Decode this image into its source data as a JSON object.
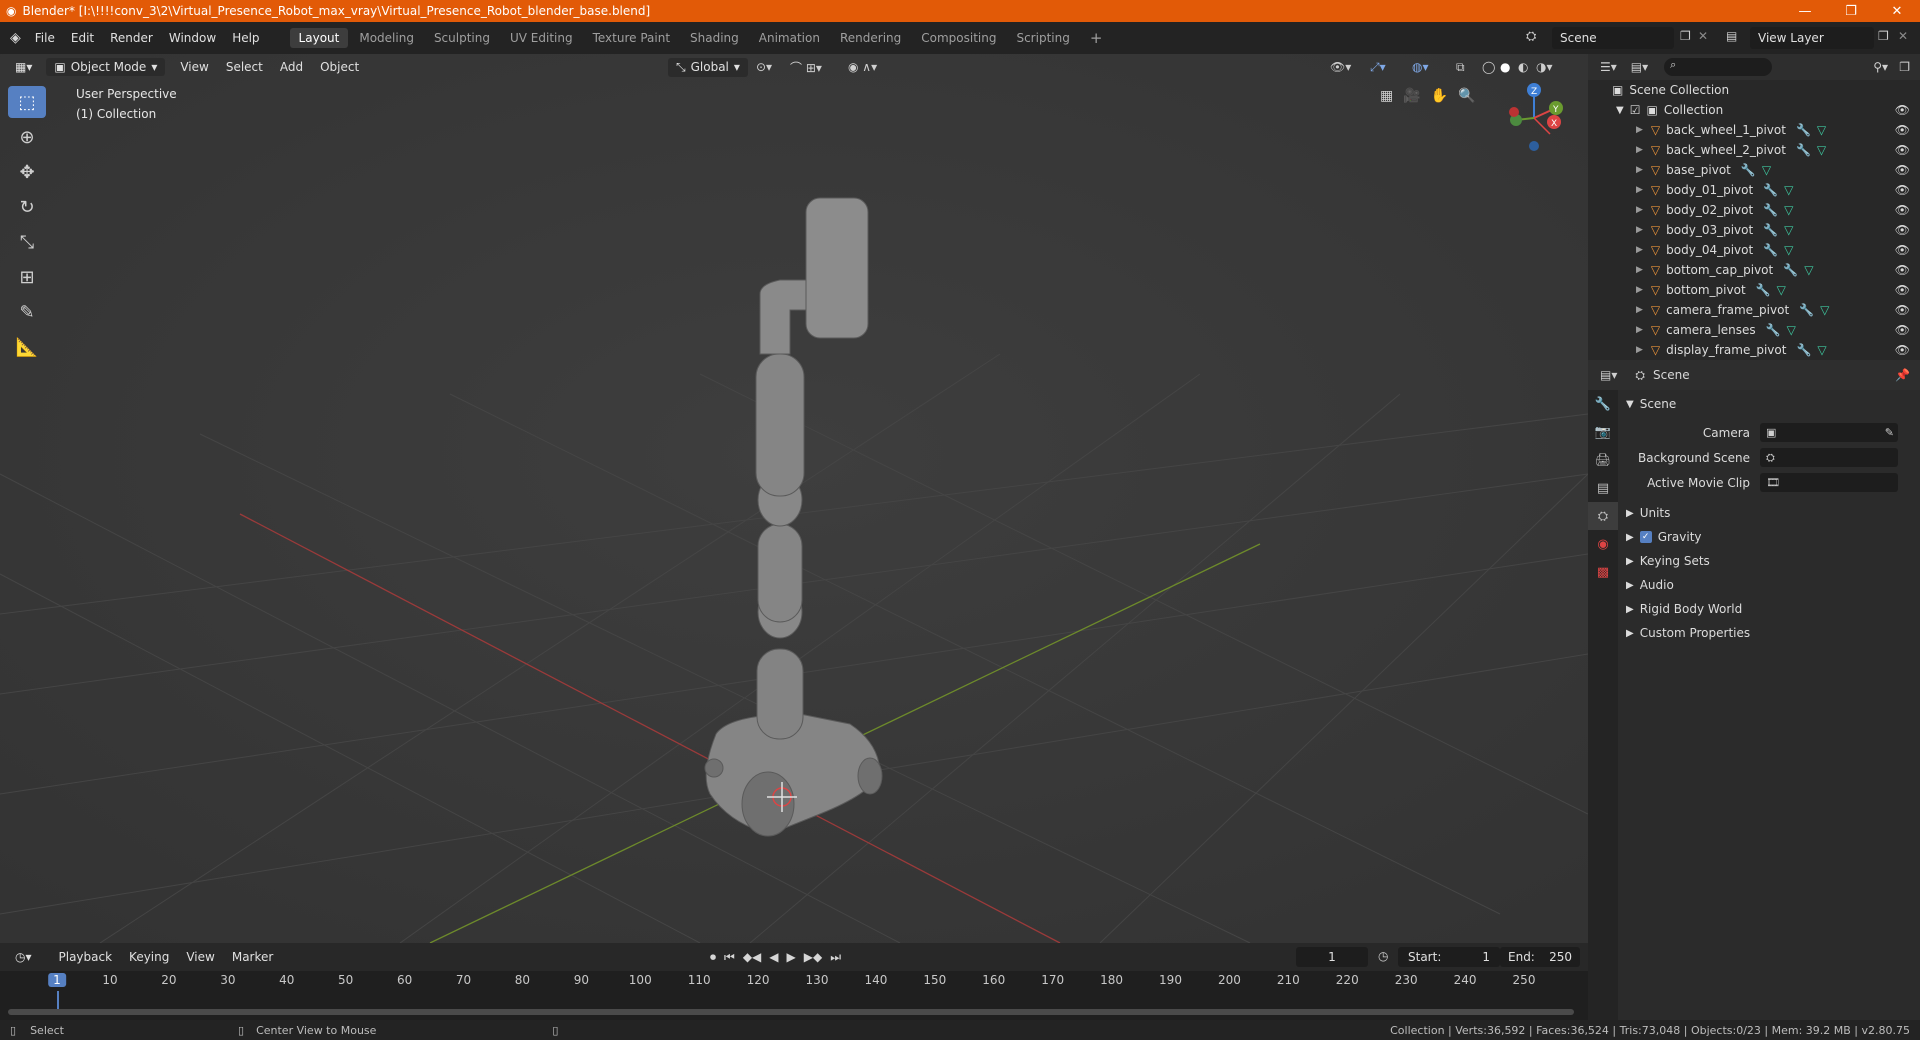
{
  "window": {
    "title": "Blender* [I:\\!!!!conv_3\\2\\Virtual_Presence_Robot_max_vray\\Virtual_Presence_Robot_blender_base.blend]"
  },
  "menu": [
    "File",
    "Edit",
    "Render",
    "Window",
    "Help"
  ],
  "workspaces": [
    "Layout",
    "Modeling",
    "Sculpting",
    "UV Editing",
    "Texture Paint",
    "Shading",
    "Animation",
    "Rendering",
    "Compositing",
    "Scripting"
  ],
  "active_workspace": "Layout",
  "scene_name": "Scene",
  "view_layer": "View Layer",
  "viewport": {
    "mode": "Object Mode",
    "menus": [
      "View",
      "Select",
      "Add",
      "Object"
    ],
    "orientation": "Global",
    "info_line1": "User Perspective",
    "info_line2": "(1) Collection"
  },
  "outliner": {
    "root": "Scene Collection",
    "collection": "Collection",
    "objects": [
      "back_wheel_1_pivot",
      "back_wheel_2_pivot",
      "base_pivot",
      "body_01_pivot",
      "body_02_pivot",
      "body_03_pivot",
      "body_04_pivot",
      "bottom_cap_pivot",
      "bottom_pivot",
      "camera_frame_pivot",
      "camera_lenses",
      "display_frame_pivot"
    ]
  },
  "properties": {
    "header": "Scene",
    "panel": "Scene",
    "camera_label": "Camera",
    "bg_scene_label": "Background Scene",
    "movie_clip_label": "Active Movie Clip",
    "sections": [
      "Units",
      "Gravity",
      "Keying Sets",
      "Audio",
      "Rigid Body World",
      "Custom Properties"
    ],
    "gravity_checked": true
  },
  "timeline": {
    "menus": [
      "Playback",
      "Keying",
      "View",
      "Marker"
    ],
    "current_frame": "1",
    "start_label": "Start:",
    "start": "1",
    "end_label": "End:",
    "end": "250",
    "ticks": [
      "1",
      "10",
      "20",
      "30",
      "40",
      "50",
      "60",
      "70",
      "80",
      "90",
      "100",
      "110",
      "120",
      "130",
      "140",
      "150",
      "160",
      "170",
      "180",
      "190",
      "200",
      "210",
      "220",
      "230",
      "240",
      "250"
    ]
  },
  "status": {
    "left": "Select",
    "middle": "Center View to Mouse",
    "right": "Collection | Verts:36,592 | Faces:36,524 | Tris:73,048 | Objects:0/23 | Mem: 39.2 MB | v2.80.75"
  }
}
